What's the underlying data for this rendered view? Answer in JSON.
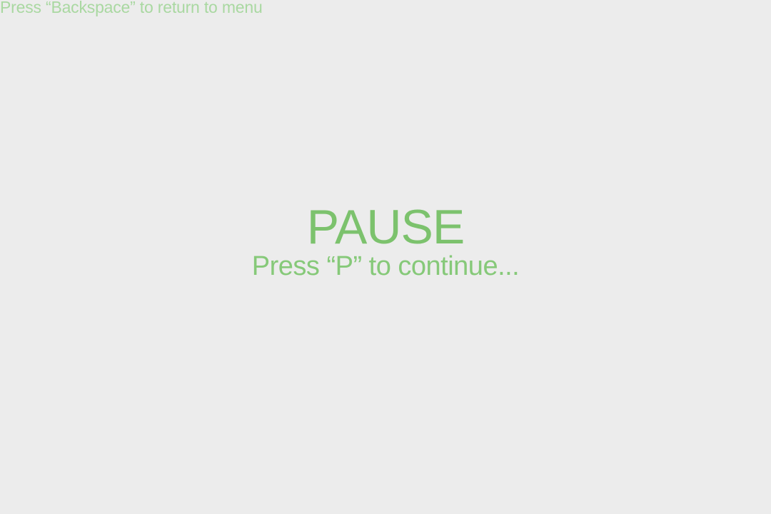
{
  "hud": {
    "menu_hint": "Press “Backspace” to return to menu"
  },
  "pause_overlay": {
    "title": "PAUSE",
    "subtitle": "Press “P” to continue..."
  },
  "colors": {
    "background": "#ececec",
    "accent_green": "#7cc26d",
    "hint_green": "#a9d8a1"
  }
}
